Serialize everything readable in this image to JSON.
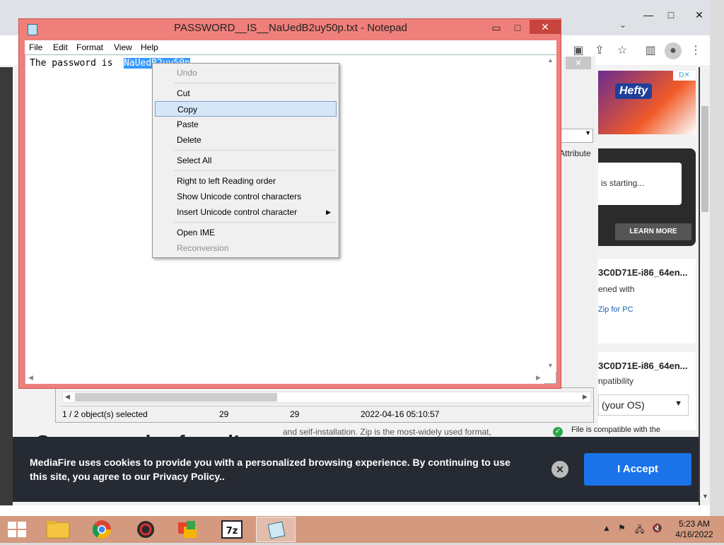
{
  "notepad": {
    "title": "PASSWORD__IS__NaUedB2uy50p.txt - Notepad",
    "menu": [
      "File",
      "Edit",
      "Format",
      "View",
      "Help"
    ],
    "text_prefix": "The password is  ",
    "text_selected": "NaUedB2uy50p",
    "buttons": {
      "minimize": "▭",
      "maximize": "□",
      "close": "✕"
    }
  },
  "context_menu": {
    "items": [
      {
        "label": "Undo",
        "disabled": true
      },
      {
        "label": "Cut"
      },
      {
        "label": "Copy",
        "highlighted": true
      },
      {
        "label": "Paste"
      },
      {
        "label": "Delete"
      },
      {
        "label": "Select All"
      },
      {
        "label": "Right to left Reading order"
      },
      {
        "label": "Show Unicode control characters"
      },
      {
        "label": "Insert Unicode control character",
        "submenu": true
      },
      {
        "label": "Open IME"
      },
      {
        "label": "Reconversion",
        "disabled": true
      }
    ]
  },
  "zip_window": {
    "status_selected": "1 / 2 object(s) selected",
    "size1": "29",
    "size2": "29",
    "modified": "2022-04-16 05:10:57",
    "column_attr": "Attribute"
  },
  "browser": {
    "window_buttons": {
      "minimize": "—",
      "restore": "□",
      "close": "✕"
    },
    "ad": {
      "brand": "Hefty",
      "badge": "D✕"
    },
    "starting_text": "is starting...",
    "learn_more": "LEARN MORE",
    "card1": {
      "title": "3C0D71E-i86_64en...",
      "line1": "ened with",
      "link": "Zip for PC"
    },
    "card2": {
      "title": "3C0D71E-i86_64en...",
      "line1": "npatibility",
      "select": "(your OS)"
    },
    "compat_text": "File is compatible with the",
    "coupon": "Coupon codes found!",
    "body_text": "and self-installation. Zip is the most-widely used format,",
    "cookie": {
      "text": "MediaFire uses cookies to provide you with a personalized browsing experience. By continuing to use this site, you agree to our Privacy Policy..",
      "close": "✕",
      "accept": "I Accept"
    }
  },
  "taskbar": {
    "time": "5:23 AM",
    "date": "4/16/2022",
    "apps": [
      "file-explorer",
      "chrome",
      "security-app",
      "office-app",
      "7zip",
      "notepad"
    ],
    "zip_label": "7z"
  },
  "colors": {
    "notepad_frame": "#ef7f7a",
    "selection": "#3399ff",
    "accept": "#1a73e8",
    "taskbar": "#d39a80"
  }
}
